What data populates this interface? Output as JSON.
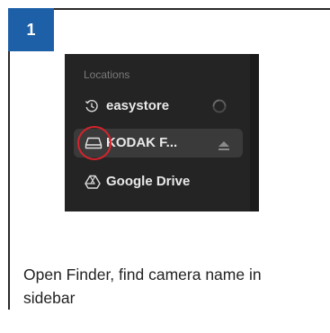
{
  "step": {
    "number": "1",
    "color": "#1e60a8"
  },
  "finder": {
    "section_heading": "Locations",
    "items": [
      {
        "label": "easystore",
        "icon": "clock-drive-icon",
        "trailing": "sync-spinner-icon",
        "selected": false
      },
      {
        "label": "KODAK F...",
        "icon": "external-drive-icon",
        "trailing": "eject-icon",
        "selected": true
      },
      {
        "label": "Google Drive",
        "icon": "google-drive-icon",
        "trailing": "",
        "selected": false
      }
    ]
  },
  "highlight_color": "#d6232b",
  "caption": "Open Finder, find camera name in sidebar"
}
